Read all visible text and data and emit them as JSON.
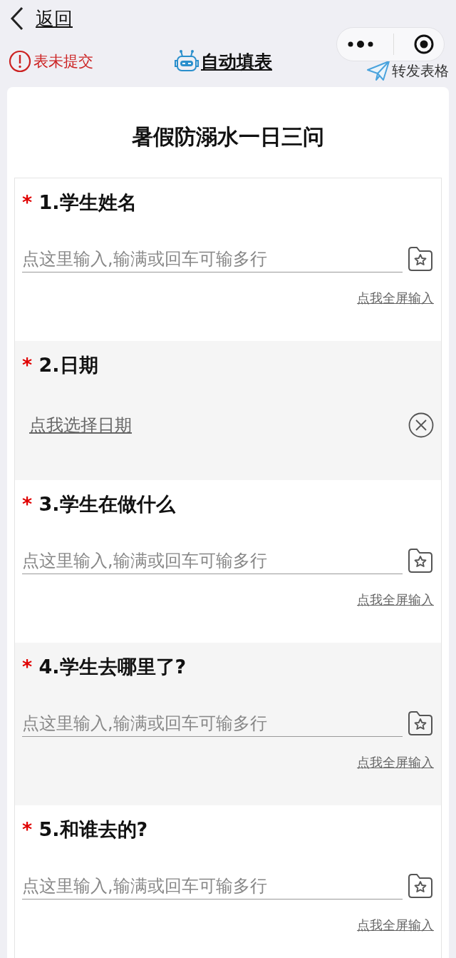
{
  "nav": {
    "back": "返回"
  },
  "toolbar": {
    "status": "表未提交",
    "autofill": "自动填表",
    "share": "转发表格"
  },
  "form": {
    "title": "暑假防溺水一日三问",
    "questions": [
      {
        "kind": "text",
        "marker": "*",
        "label": "1.学生姓名",
        "placeholder": "点这里输入,输满或回车可输多行",
        "link": "点我全屏输入"
      },
      {
        "kind": "date",
        "marker": "*",
        "label": "2.日期",
        "value": "点我选择日期"
      },
      {
        "kind": "text",
        "marker": "*",
        "label": "3.学生在做什么",
        "placeholder": "点这里输入,输满或回车可输多行",
        "link": "点我全屏输入"
      },
      {
        "kind": "text",
        "marker": "*",
        "label": "4.学生去哪里了?",
        "placeholder": "点这里输入,输满或回车可输多行",
        "link": "点我全屏输入"
      },
      {
        "kind": "text",
        "marker": "*",
        "label": "5.和谁去的?",
        "placeholder": "点这里输入,输满或回车可输多行",
        "link": "点我全屏输入"
      }
    ]
  }
}
